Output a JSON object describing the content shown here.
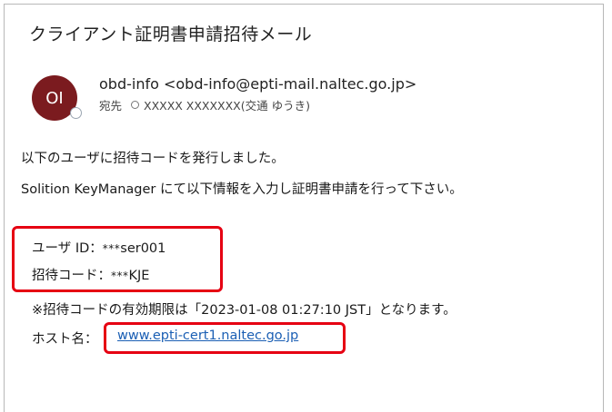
{
  "email": {
    "subject": "クライアント証明書申請招待メール",
    "sender": {
      "avatar_initials": "OI",
      "display": "obd-info <obd-info@epti-mail.naltec.go.jp>"
    },
    "to": {
      "label": "宛先",
      "recipient": "XXXXX XXXXXXX(交通 ゆうき)"
    },
    "body": {
      "line1": "以下のユーザに招待コードを発行しました。",
      "line2": "Solition KeyManager にて以下情報を入力し証明書申請を行って下さい。",
      "user_id_label": "ユーザ ID：",
      "user_id_mask": "***",
      "user_id_value": "ser001",
      "invite_code_label": "招待コード：",
      "invite_code_mask": "***",
      "invite_code_value": "KJE",
      "expiry_note": "※招待コードの有効期限は「2023-01-08 01:27:10 JST」となります。",
      "host_label": "ホスト名：",
      "host_link": "www.epti-cert1.naltec.go.jp"
    }
  },
  "colors": {
    "avatar_bg": "#7b1b1f",
    "highlight": "#e60012",
    "link": "#1b5fb4"
  }
}
